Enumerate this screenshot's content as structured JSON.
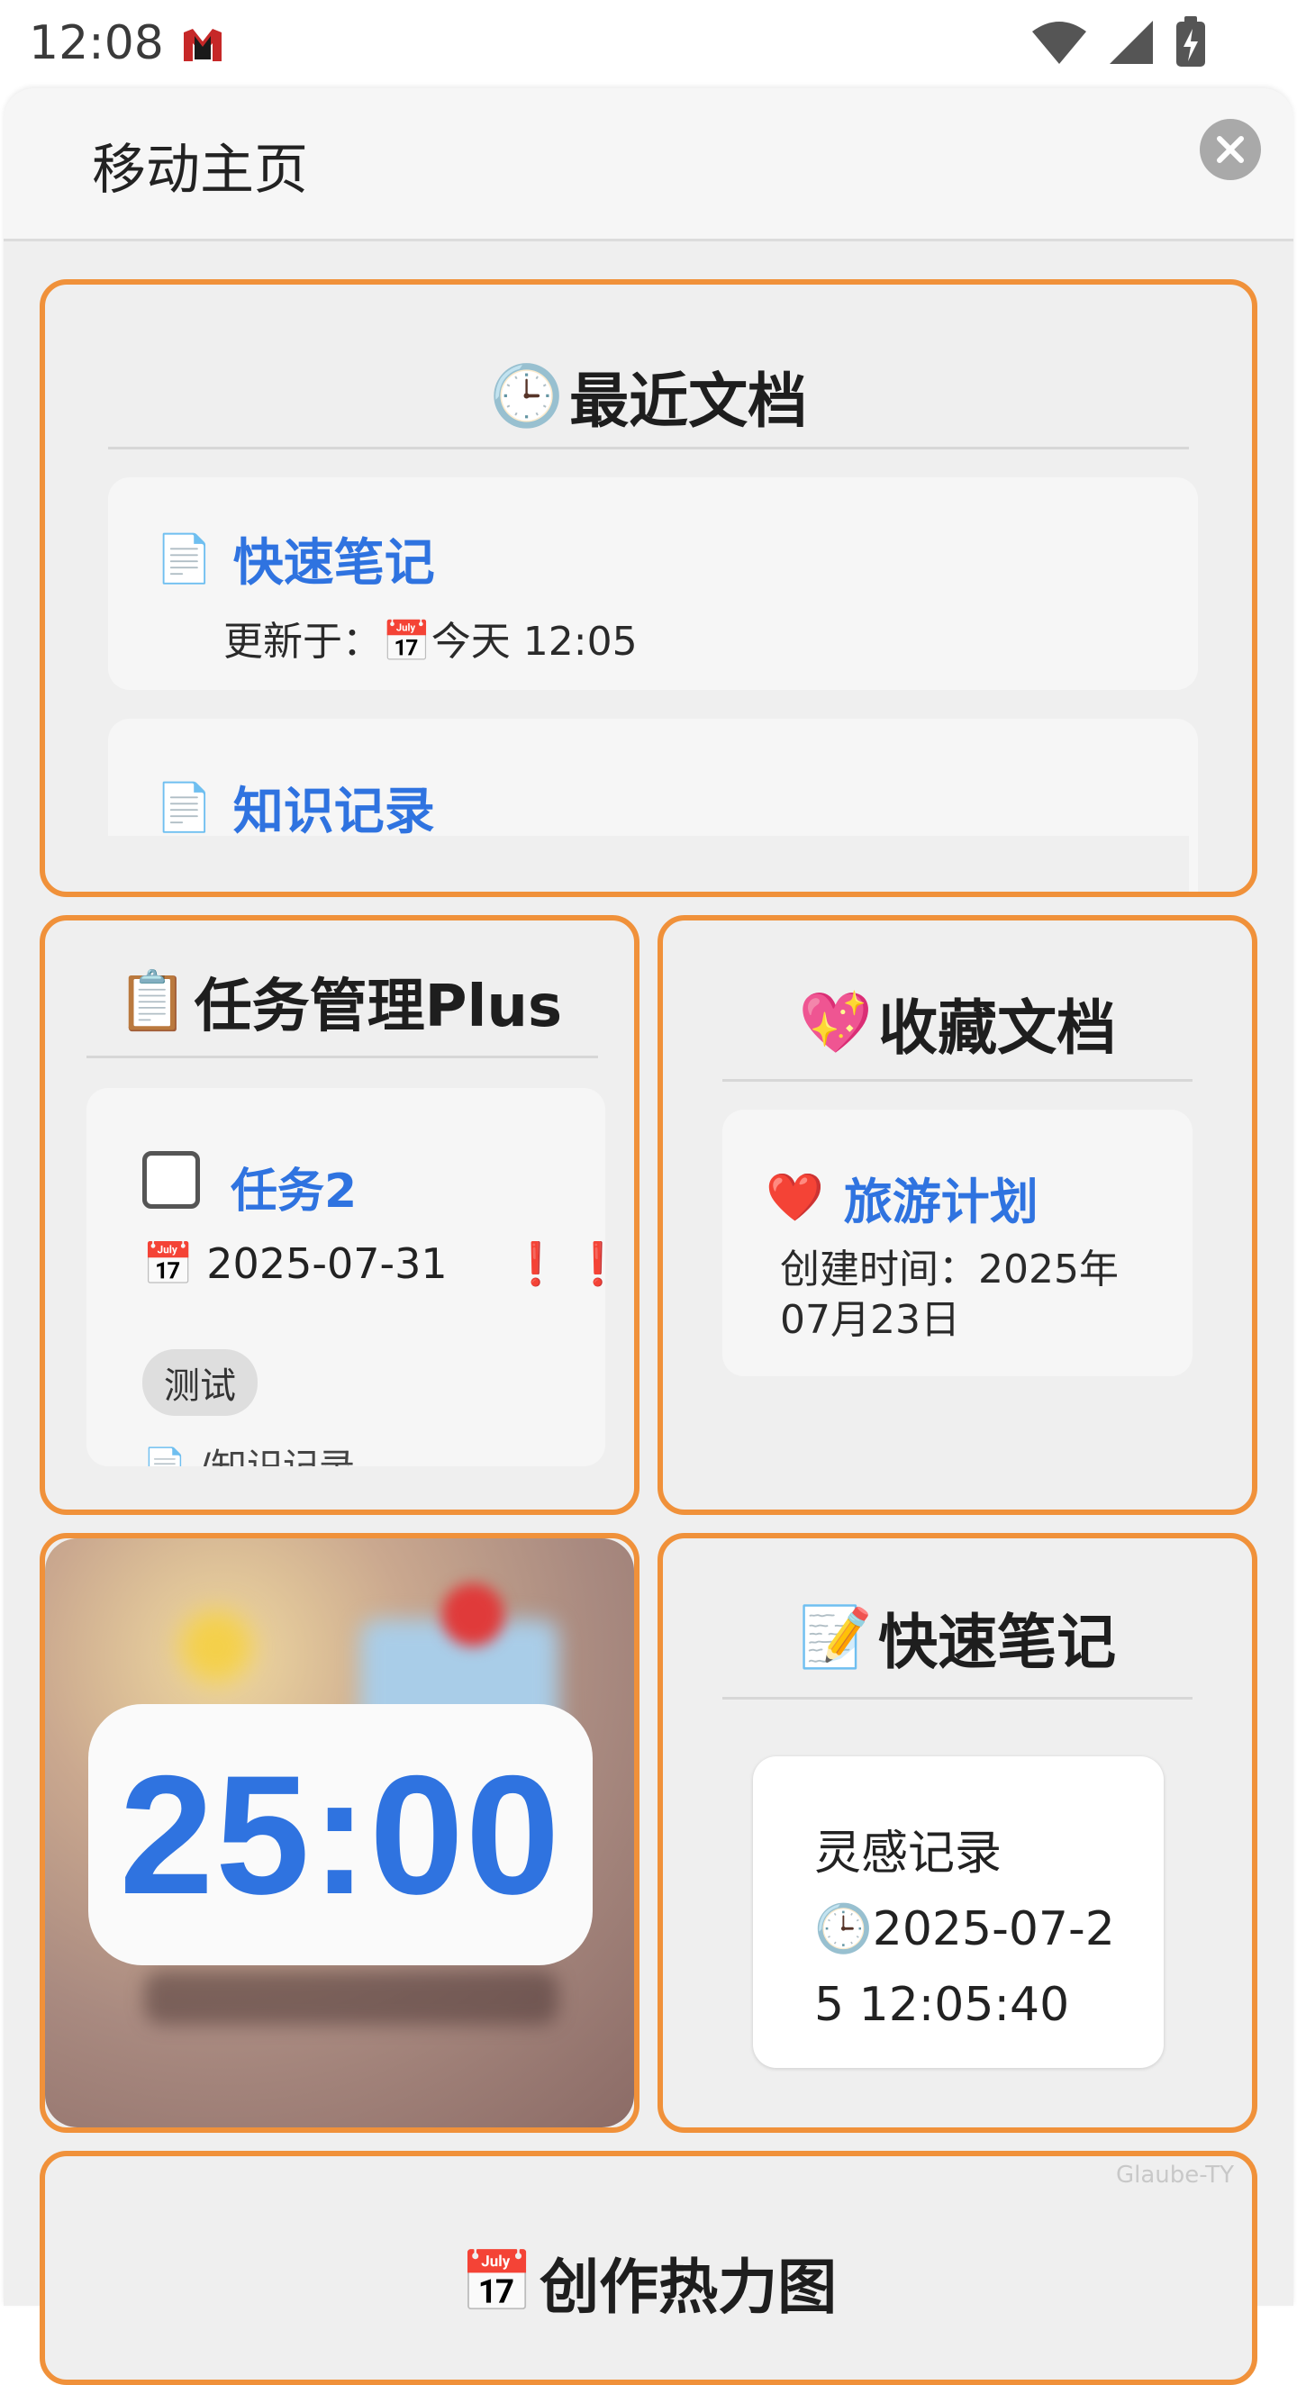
{
  "status_bar": {
    "time": "12:08"
  },
  "sheet": {
    "title": "移动主页"
  },
  "recent_docs": {
    "emoji": "🕒",
    "title": "最近文档",
    "items": [
      {
        "icon": "📄",
        "title": "快速笔记",
        "updated_label": "更新于：",
        "date_icon": "📅",
        "updated": "今天 12:05"
      },
      {
        "icon": "📄",
        "title": "知识记录"
      }
    ]
  },
  "task_plus": {
    "emoji": "📋",
    "title": "任务管理Plus",
    "task": {
      "title": "任务2",
      "date_icon": "📅",
      "date": "2025-07-31",
      "priority": "❗❗",
      "tag": "测试",
      "path": "📄 /知识记录"
    }
  },
  "favorites": {
    "emoji": "💖",
    "title": "收藏文档",
    "item": {
      "icon": "❤️",
      "title": "旅游计划",
      "created": "创建时间：2025年07月23日"
    }
  },
  "pomodoro": {
    "time": "25:00"
  },
  "quick_note": {
    "emoji": "📝",
    "title": "快速笔记",
    "note": {
      "title": "灵感记录",
      "time": "🕒2025-07-25 12:05:40"
    }
  },
  "heatmap": {
    "emoji": "📅",
    "title": "创作热力图"
  },
  "watermark": "Glaube-TY",
  "colors": {
    "accent": "#f0913a",
    "link": "#2f73e0"
  }
}
